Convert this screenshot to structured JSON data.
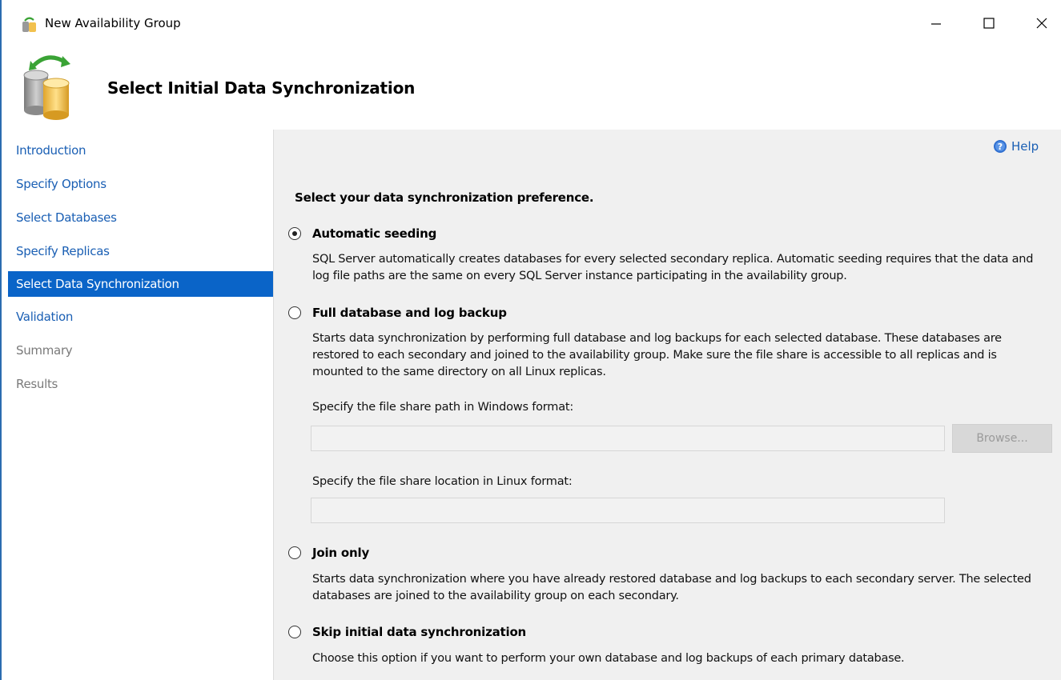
{
  "window": {
    "title": "New Availability Group",
    "controls": [
      "minimize-icon",
      "maximize-icon",
      "close-icon"
    ]
  },
  "header": {
    "title": "Select Initial Data Synchronization",
    "icon": "database-sync-icon"
  },
  "sidebar": {
    "items": [
      {
        "label": "Introduction",
        "state": "link"
      },
      {
        "label": "Specify Options",
        "state": "link"
      },
      {
        "label": "Select Databases",
        "state": "link"
      },
      {
        "label": "Specify Replicas",
        "state": "link"
      },
      {
        "label": "Select Data Synchronization",
        "state": "active"
      },
      {
        "label": "Validation",
        "state": "link"
      },
      {
        "label": "Summary",
        "state": "disabled"
      },
      {
        "label": "Results",
        "state": "disabled"
      }
    ]
  },
  "content": {
    "help_label": "Help",
    "prompt": "Select your data synchronization preference.",
    "options": [
      {
        "label": "Automatic seeding",
        "selected": true,
        "description": "SQL Server automatically creates databases for every selected secondary replica. Automatic seeding requires that the data and log file paths are the same on every SQL Server instance participating in the availability group."
      },
      {
        "label": "Full database and log backup",
        "selected": false,
        "description": "Starts data synchronization by performing full database and log backups for each selected database. These databases are restored to each secondary and joined to the availability group. Make sure the file share is accessible to all replicas and is mounted to the same directory on all Linux replicas."
      },
      {
        "label": "Join only",
        "selected": false,
        "description": "Starts data synchronization where you have already restored database and log backups to each secondary server. The selected databases are joined to the availability group on each secondary."
      },
      {
        "label": "Skip initial data synchronization",
        "selected": false,
        "description": "Choose this option if you want to perform your own database and log backups of each primary database."
      }
    ],
    "windows_path_label": "Specify the file share path in Windows format:",
    "windows_path_value": "",
    "linux_path_label": "Specify the file share location in Linux format:",
    "linux_path_value": "",
    "browse_label": "Browse..."
  },
  "colors": {
    "accent": "#0a64c8",
    "link": "#1a5fb4",
    "content_bg": "#f0f0f0"
  }
}
